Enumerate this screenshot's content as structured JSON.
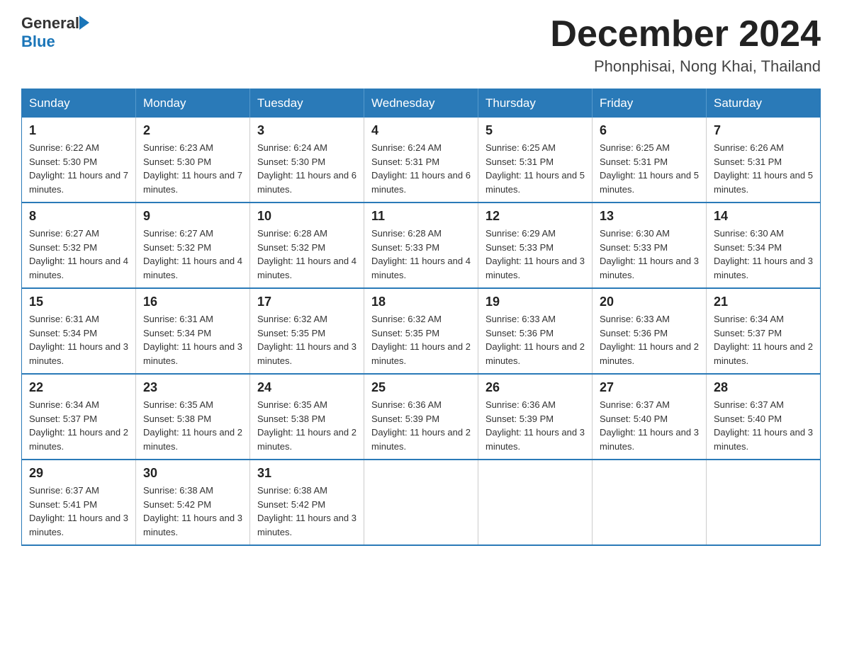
{
  "header": {
    "logo_general": "General",
    "logo_blue": "Blue",
    "month_title": "December 2024",
    "location": "Phonphisai, Nong Khai, Thailand"
  },
  "days_of_week": [
    "Sunday",
    "Monday",
    "Tuesday",
    "Wednesday",
    "Thursday",
    "Friday",
    "Saturday"
  ],
  "weeks": [
    [
      {
        "day": "1",
        "sunrise": "6:22 AM",
        "sunset": "5:30 PM",
        "daylight": "11 hours and 7 minutes."
      },
      {
        "day": "2",
        "sunrise": "6:23 AM",
        "sunset": "5:30 PM",
        "daylight": "11 hours and 7 minutes."
      },
      {
        "day": "3",
        "sunrise": "6:24 AM",
        "sunset": "5:30 PM",
        "daylight": "11 hours and 6 minutes."
      },
      {
        "day": "4",
        "sunrise": "6:24 AM",
        "sunset": "5:31 PM",
        "daylight": "11 hours and 6 minutes."
      },
      {
        "day": "5",
        "sunrise": "6:25 AM",
        "sunset": "5:31 PM",
        "daylight": "11 hours and 5 minutes."
      },
      {
        "day": "6",
        "sunrise": "6:25 AM",
        "sunset": "5:31 PM",
        "daylight": "11 hours and 5 minutes."
      },
      {
        "day": "7",
        "sunrise": "6:26 AM",
        "sunset": "5:31 PM",
        "daylight": "11 hours and 5 minutes."
      }
    ],
    [
      {
        "day": "8",
        "sunrise": "6:27 AM",
        "sunset": "5:32 PM",
        "daylight": "11 hours and 4 minutes."
      },
      {
        "day": "9",
        "sunrise": "6:27 AM",
        "sunset": "5:32 PM",
        "daylight": "11 hours and 4 minutes."
      },
      {
        "day": "10",
        "sunrise": "6:28 AM",
        "sunset": "5:32 PM",
        "daylight": "11 hours and 4 minutes."
      },
      {
        "day": "11",
        "sunrise": "6:28 AM",
        "sunset": "5:33 PM",
        "daylight": "11 hours and 4 minutes."
      },
      {
        "day": "12",
        "sunrise": "6:29 AM",
        "sunset": "5:33 PM",
        "daylight": "11 hours and 3 minutes."
      },
      {
        "day": "13",
        "sunrise": "6:30 AM",
        "sunset": "5:33 PM",
        "daylight": "11 hours and 3 minutes."
      },
      {
        "day": "14",
        "sunrise": "6:30 AM",
        "sunset": "5:34 PM",
        "daylight": "11 hours and 3 minutes."
      }
    ],
    [
      {
        "day": "15",
        "sunrise": "6:31 AM",
        "sunset": "5:34 PM",
        "daylight": "11 hours and 3 minutes."
      },
      {
        "day": "16",
        "sunrise": "6:31 AM",
        "sunset": "5:34 PM",
        "daylight": "11 hours and 3 minutes."
      },
      {
        "day": "17",
        "sunrise": "6:32 AM",
        "sunset": "5:35 PM",
        "daylight": "11 hours and 3 minutes."
      },
      {
        "day": "18",
        "sunrise": "6:32 AM",
        "sunset": "5:35 PM",
        "daylight": "11 hours and 2 minutes."
      },
      {
        "day": "19",
        "sunrise": "6:33 AM",
        "sunset": "5:36 PM",
        "daylight": "11 hours and 2 minutes."
      },
      {
        "day": "20",
        "sunrise": "6:33 AM",
        "sunset": "5:36 PM",
        "daylight": "11 hours and 2 minutes."
      },
      {
        "day": "21",
        "sunrise": "6:34 AM",
        "sunset": "5:37 PM",
        "daylight": "11 hours and 2 minutes."
      }
    ],
    [
      {
        "day": "22",
        "sunrise": "6:34 AM",
        "sunset": "5:37 PM",
        "daylight": "11 hours and 2 minutes."
      },
      {
        "day": "23",
        "sunrise": "6:35 AM",
        "sunset": "5:38 PM",
        "daylight": "11 hours and 2 minutes."
      },
      {
        "day": "24",
        "sunrise": "6:35 AM",
        "sunset": "5:38 PM",
        "daylight": "11 hours and 2 minutes."
      },
      {
        "day": "25",
        "sunrise": "6:36 AM",
        "sunset": "5:39 PM",
        "daylight": "11 hours and 2 minutes."
      },
      {
        "day": "26",
        "sunrise": "6:36 AM",
        "sunset": "5:39 PM",
        "daylight": "11 hours and 3 minutes."
      },
      {
        "day": "27",
        "sunrise": "6:37 AM",
        "sunset": "5:40 PM",
        "daylight": "11 hours and 3 minutes."
      },
      {
        "day": "28",
        "sunrise": "6:37 AM",
        "sunset": "5:40 PM",
        "daylight": "11 hours and 3 minutes."
      }
    ],
    [
      {
        "day": "29",
        "sunrise": "6:37 AM",
        "sunset": "5:41 PM",
        "daylight": "11 hours and 3 minutes."
      },
      {
        "day": "30",
        "sunrise": "6:38 AM",
        "sunset": "5:42 PM",
        "daylight": "11 hours and 3 minutes."
      },
      {
        "day": "31",
        "sunrise": "6:38 AM",
        "sunset": "5:42 PM",
        "daylight": "11 hours and 3 minutes."
      },
      null,
      null,
      null,
      null
    ]
  ]
}
